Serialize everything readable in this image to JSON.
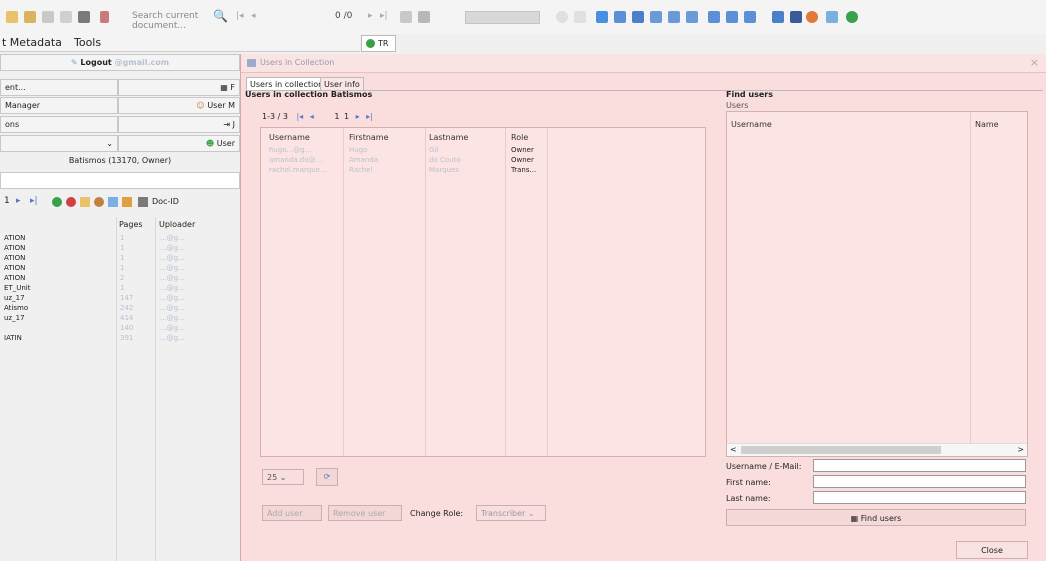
{
  "toolbar": {
    "search_placeholder": "Search current document...",
    "page_indicator": "0 /0",
    "accent": "#3a7bd5"
  },
  "menu": {
    "items": [
      "t Metadata",
      "Tools"
    ]
  },
  "doc_tab": {
    "label": "TR"
  },
  "left_panel": {
    "logout_label": "Logout",
    "logout_email": "@gmail.com",
    "row_document": "ent...",
    "row_manager": "Manager",
    "row_user_manager": "User M",
    "row_ons": "ons",
    "row_user": "User",
    "collection_label": "Batismos (13170, Owner)",
    "pager": "1",
    "docid_label": "Doc-ID",
    "col_pages": "Pages",
    "col_uploader": "Uploader",
    "rows": [
      {
        "title": "ATION",
        "pages": "1",
        "uploader": "...@g..."
      },
      {
        "title": "ATION",
        "pages": "1",
        "uploader": "...@g..."
      },
      {
        "title": "ATION",
        "pages": "1",
        "uploader": "...@g..."
      },
      {
        "title": "ATION",
        "pages": "1",
        "uploader": "...@g..."
      },
      {
        "title": "ATION",
        "pages": "2",
        "uploader": "...@g..."
      },
      {
        "title": "ET_Unit",
        "pages": "1",
        "uploader": "...@g..."
      },
      {
        "title": "uz_17",
        "pages": "147",
        "uploader": "...@g..."
      },
      {
        "title": "Atismo",
        "pages": "242",
        "uploader": "...@g..."
      },
      {
        "title": "uz_17",
        "pages": "414",
        "uploader": "...@g..."
      },
      {
        "title": "",
        "pages": "140",
        "uploader": "...@g..."
      },
      {
        "title": "IATIN",
        "pages": "391",
        "uploader": "...@g..."
      }
    ]
  },
  "dialog": {
    "title": "Users in Collection",
    "tabs": [
      "Users in collection",
      "User info"
    ],
    "section_title": "Users in collection Batismos",
    "pager_range": "1-3 / 3",
    "pager_page": "1",
    "pager_total": "1",
    "columns": [
      "Username",
      "Firstname",
      "Lastname",
      "Role"
    ],
    "users": [
      {
        "username": "hugo...@g...",
        "firstname": "Hugo",
        "lastname": "Gil",
        "role": "Owner"
      },
      {
        "username": "amanda.do@...",
        "firstname": "Amanda",
        "lastname": "do Couto",
        "role": "Owner"
      },
      {
        "username": "rachel.marque...",
        "firstname": "Rachel",
        "lastname": "Marques",
        "role": "Trans..."
      }
    ],
    "page_size": "25",
    "add_user": "Add user",
    "remove_user": "Remove user",
    "change_role_label": "Change Role:",
    "role_select": "Transcriber",
    "find_title": "Find users",
    "find_users_label": "Users",
    "find_columns": [
      "Username",
      "Name"
    ],
    "field_username": "Username / E-Mail:",
    "field_firstname": "First name:",
    "field_lastname": "Last name:",
    "find_button": "Find users",
    "close_button": "Close"
  }
}
